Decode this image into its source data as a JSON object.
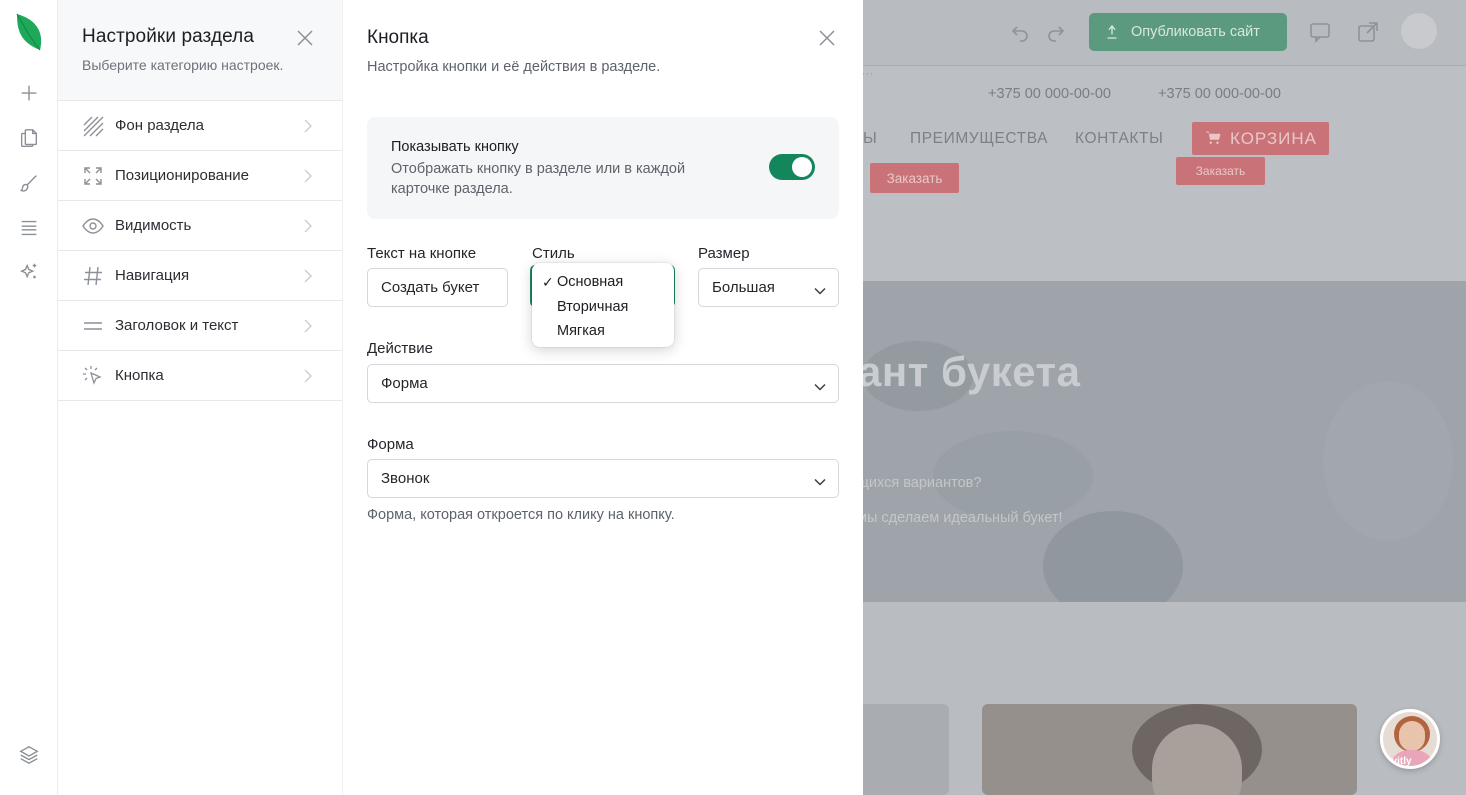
{
  "app": {
    "colors": {
      "accent": "#14865b",
      "sidebar_bg": "#f7f8fa",
      "cart": "#c97378"
    }
  },
  "rail": {
    "icons": [
      "leaf-logo-icon",
      "plus-icon",
      "pages-icon",
      "brush-icon",
      "layers-list-icon",
      "sparkles-icon",
      "stack-icon"
    ]
  },
  "settings": {
    "title": "Настройки раздела",
    "subtitle": "Выберите категорию настроек.",
    "items": [
      {
        "label": "Фон раздела",
        "icon": "background-hatch-icon"
      },
      {
        "label": "Позиционирование",
        "icon": "expand-arrows-icon"
      },
      {
        "label": "Видимость",
        "icon": "eye-icon"
      },
      {
        "label": "Навигация",
        "icon": "hash-icon"
      },
      {
        "label": "Заголовок и текст",
        "icon": "text-lines-icon"
      },
      {
        "label": "Кнопка",
        "icon": "cursor-click-icon"
      }
    ]
  },
  "panel": {
    "title": "Кнопка",
    "subtitle": "Настройка кнопки и её действия в разделе.",
    "show_button": {
      "title": "Показывать кнопку",
      "description": "Отображать кнопку в разделе или в каждой карточке раздела.",
      "enabled": true
    },
    "button_text": {
      "label": "Текст на кнопке",
      "value": "Создать букет"
    },
    "style": {
      "label": "Стиль",
      "options": [
        "Основная",
        "Вторичная",
        "Мягкая"
      ],
      "selected": "Основная",
      "check": "✓"
    },
    "size": {
      "label": "Размер",
      "value": "Большая"
    },
    "action": {
      "label": "Действие",
      "value": "Форма"
    },
    "form": {
      "label": "Форма",
      "value": "Звонок",
      "hint": "Форма, которая откроется по клику на кнопку."
    }
  },
  "preview": {
    "publish_label": "Опубликовать сайт",
    "phone_1": "+375 00 000-00-00",
    "phone_2": "+375 00 000-00-00",
    "nav_items": [
      "ПРЕИМУЩЕСТВА",
      "КОНТАКТЫ"
    ],
    "nav_partial": "Ы",
    "cart_label": "КОРЗИНА",
    "order_label": "Заказать",
    "hero_title": "ант букета",
    "hero_q": "щихся вариантов?",
    "hero_a": "мы сделаем идеальный букет!",
    "chat_label": "kvitly"
  }
}
